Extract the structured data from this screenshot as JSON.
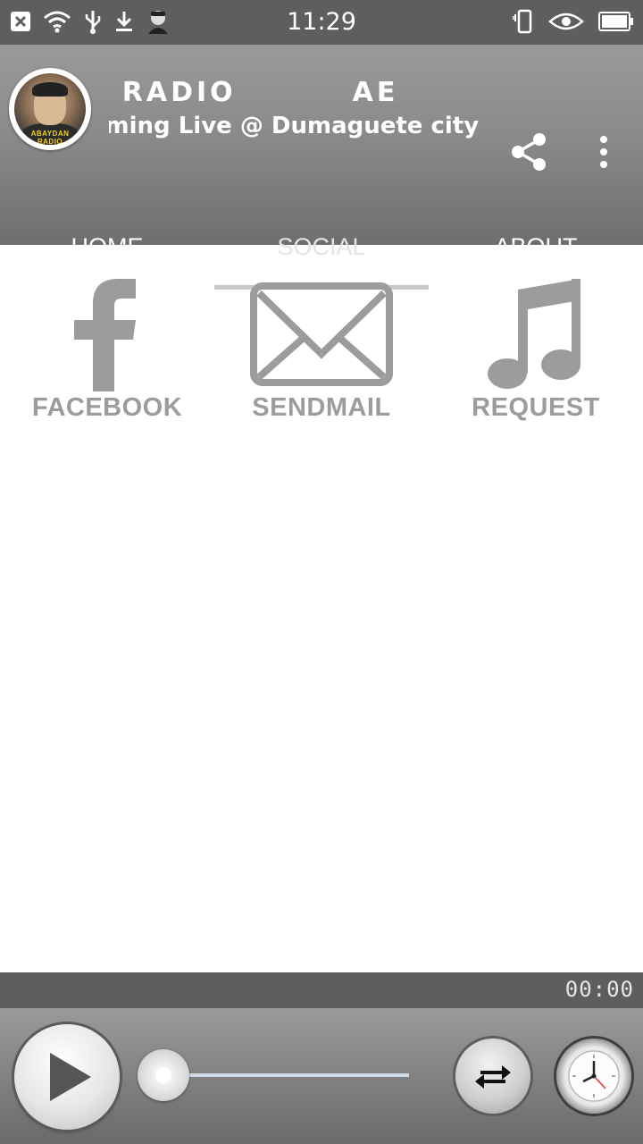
{
  "status_bar": {
    "time": "11:29",
    "left_icons": [
      "close-notification-icon",
      "wifi-icon",
      "usb-icon",
      "download-icon",
      "avatar-notification-icon"
    ],
    "right_icons": [
      "vibrate-icon",
      "eye-icon",
      "battery-icon"
    ]
  },
  "header": {
    "station_title": "AN RADIO",
    "station_title_repeat": "AE",
    "subtitle": "aming Live @ Dumaguete city n",
    "logo_text": "ABAYDAN RADIO",
    "actions": [
      "share-icon",
      "more-options-icon"
    ]
  },
  "tabs": [
    {
      "label": "HOME",
      "active": false
    },
    {
      "label": "SOCIAL",
      "active": true
    },
    {
      "label": "ABOUT",
      "active": false
    }
  ],
  "social_items": [
    {
      "label": "FACEBOOK",
      "icon": "facebook-icon"
    },
    {
      "label": "SENDMAIL",
      "icon": "mail-icon"
    },
    {
      "label": "REQUEST",
      "icon": "music-note-icon"
    }
  ],
  "player": {
    "elapsed": "00:00",
    "progress": 0,
    "buttons": [
      "play-icon",
      "swap-icon",
      "clock-icon"
    ]
  },
  "colors": {
    "header_gray": "#8a8a8a",
    "dark_bar": "#5e5e5e",
    "icon_gray": "#9c9c9c"
  }
}
